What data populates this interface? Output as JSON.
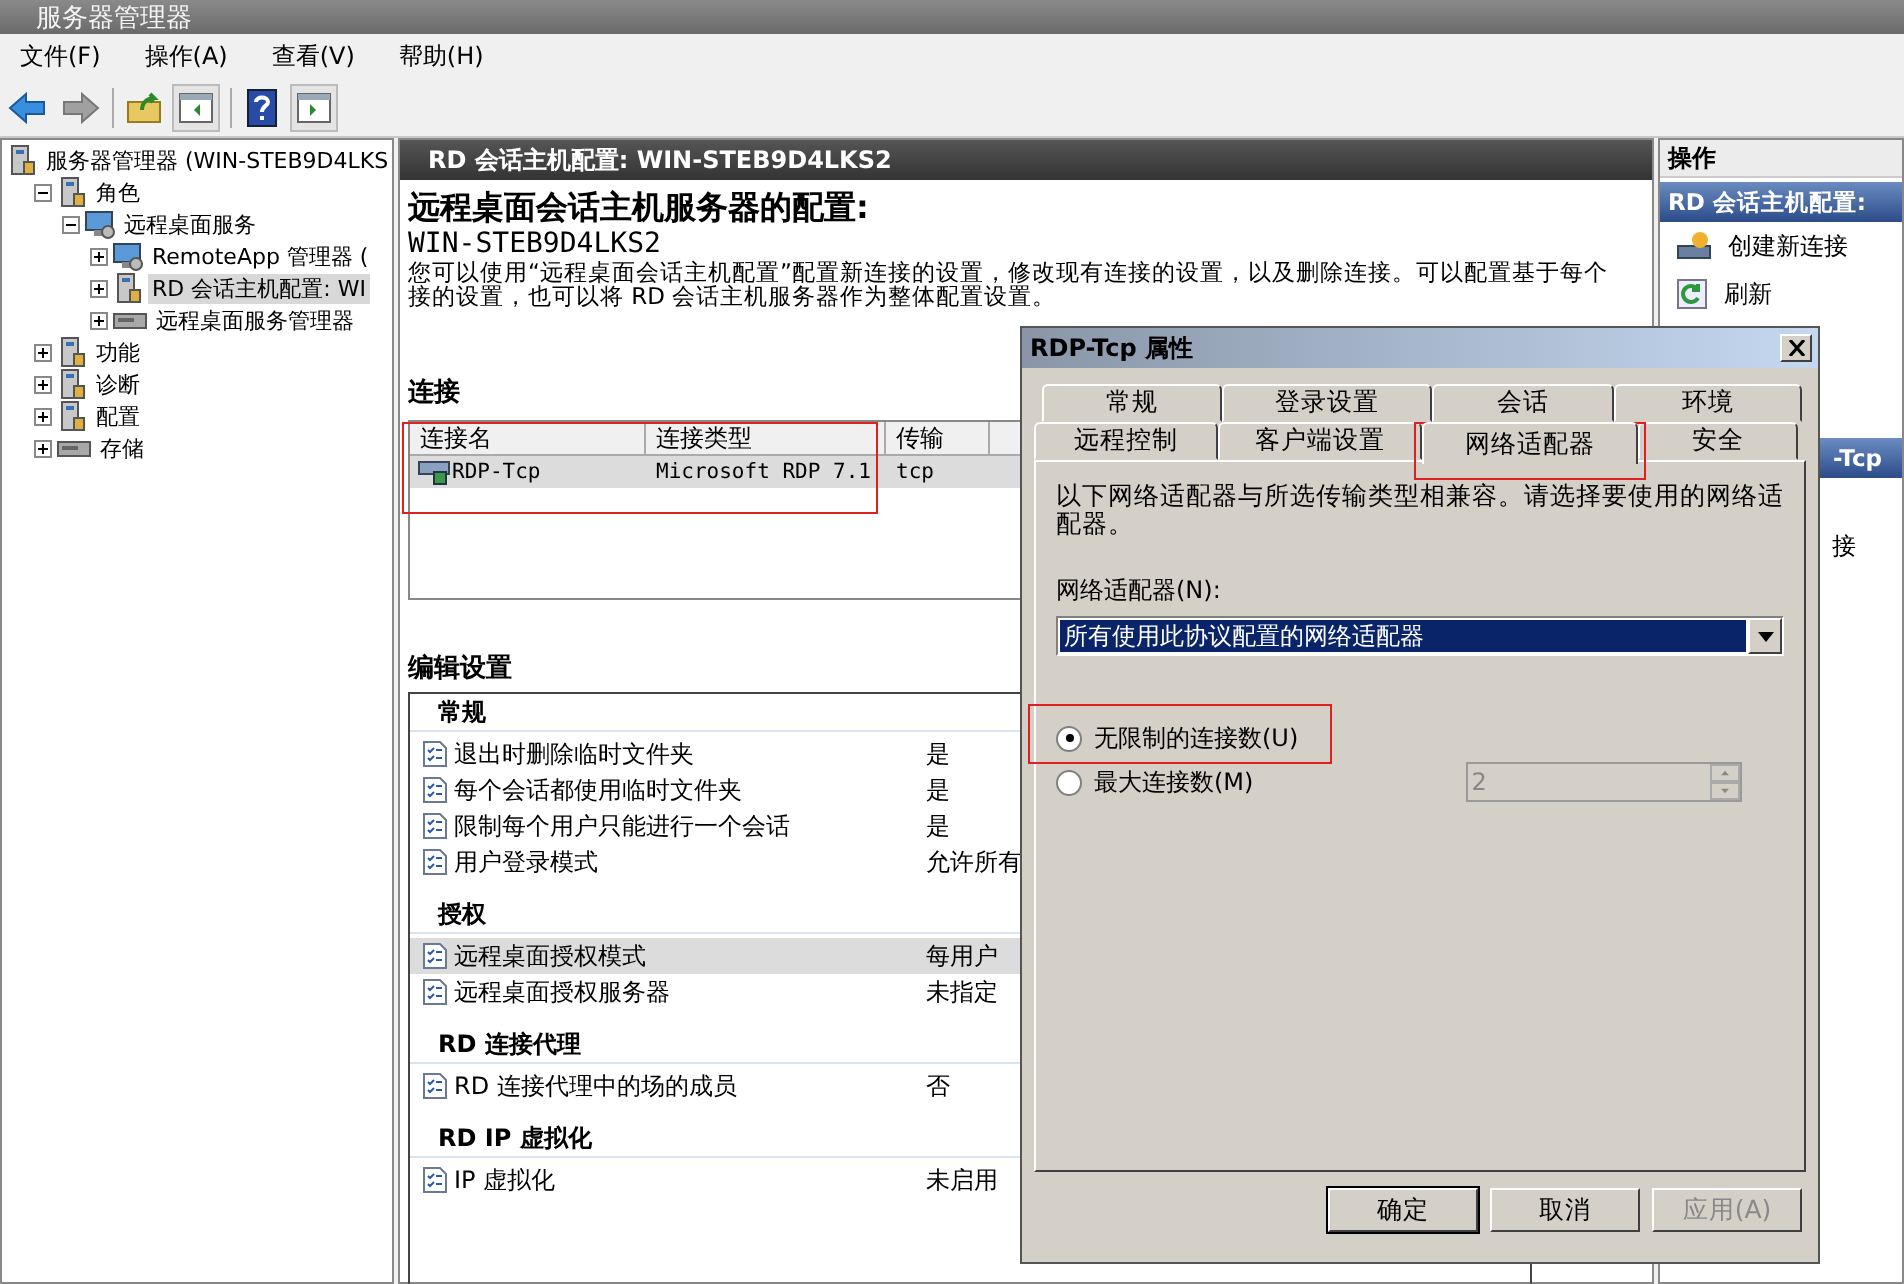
{
  "window": {
    "title": "服务器管理器"
  },
  "menu": [
    {
      "label": "文件(F)"
    },
    {
      "label": "操作(A)"
    },
    {
      "label": "查看(V)"
    },
    {
      "label": "帮助(H)"
    }
  ],
  "tree": [
    {
      "label": "服务器管理器 (WIN-STEB9D4LKS",
      "kind": "server",
      "selected": false,
      "children": [
        {
          "label": "角色",
          "kind": "server",
          "expanded": true,
          "selected": false,
          "children": [
            {
              "label": "远程桌面服务",
              "kind": "monitor",
              "expanded": true,
              "selected": false,
              "children": [
                {
                  "label": "RemoteApp 管理器 (",
                  "kind": "monitor",
                  "expanded": false,
                  "selected": false
                },
                {
                  "label": "RD 会话主机配置: WI",
                  "kind": "server",
                  "expanded": false,
                  "selected": true
                },
                {
                  "label": "远程桌面服务管理器",
                  "kind": "drive",
                  "expanded": false,
                  "selected": false
                }
              ]
            }
          ]
        },
        {
          "label": "功能",
          "kind": "server",
          "expanded": false,
          "selected": false
        },
        {
          "label": "诊断",
          "kind": "server",
          "expanded": false,
          "selected": false
        },
        {
          "label": "配置",
          "kind": "server",
          "expanded": false,
          "selected": false
        },
        {
          "label": "存储",
          "kind": "drive",
          "expanded": false,
          "selected": false
        }
      ]
    }
  ],
  "center": {
    "header": "RD 会话主机配置: WIN-STEB9D4LKS2",
    "title": "远程桌面会话主机服务器的配置:",
    "server": "WIN-STEB9D4LKS2",
    "description": [
      "您可以使用“远程桌面会话主机配置”配置新连接的设置，修改现有连接的设置，以及删除连接。可以配置基于每个",
      "接的设置，也可以将 RD 会话主机服务器作为整体配置设置。"
    ],
    "connections": {
      "title": "连接",
      "highlighted": true,
      "columns": [
        "连接名",
        "连接类型",
        "传输"
      ],
      "rows": [
        {
          "cells": [
            "RDP-Tcp",
            "Microsoft RDP 7.1",
            "tcp"
          ],
          "selected": true
        }
      ]
    },
    "settings": {
      "title": "编辑设置",
      "groups": [
        {
          "title": "常规",
          "items": [
            {
              "name": "退出时删除临时文件夹",
              "value": "是",
              "selected": false
            },
            {
              "name": "每个会话都使用临时文件夹",
              "value": "是",
              "selected": false
            },
            {
              "name": "限制每个用户只能进行一个会话",
              "value": "是",
              "selected": false
            },
            {
              "name": "用户登录模式",
              "value": "允许所有",
              "selected": false
            }
          ]
        },
        {
          "title": "授权",
          "items": [
            {
              "name": "远程桌面授权模式",
              "value": "每用户",
              "selected": true
            },
            {
              "name": "远程桌面授权服务器",
              "value": "未指定",
              "selected": false
            }
          ]
        },
        {
          "title": "RD 连接代理",
          "items": [
            {
              "name": "RD 连接代理中的场的成员",
              "value": "否",
              "selected": false
            }
          ]
        },
        {
          "title": "RD IP 虚拟化",
          "items": [
            {
              "name": "IP 虚拟化",
              "value": "未启用",
              "selected": false
            }
          ]
        }
      ]
    }
  },
  "actions": {
    "title": "操作",
    "header": "RD 会话主机配置:",
    "items": [
      {
        "label": "创建新连接",
        "kind": "new"
      },
      {
        "label": "刷新",
        "kind": "refresh"
      }
    ],
    "header2": "-Tcp",
    "fragment": "接"
  },
  "dialog": {
    "title": "RDP-Tcp 属性",
    "tab_rows": [
      [
        {
          "label": "常规",
          "selected": false,
          "highlighted": false
        },
        {
          "label": "登录设置",
          "selected": false,
          "highlighted": false
        },
        {
          "label": "会话",
          "selected": false,
          "highlighted": false
        },
        {
          "label": "环境",
          "selected": false,
          "highlighted": false
        }
      ],
      [
        {
          "label": "远程控制",
          "selected": false,
          "highlighted": false
        },
        {
          "label": "客户端设置",
          "selected": false,
          "highlighted": false
        },
        {
          "label": "网络适配器",
          "selected": true,
          "highlighted": true
        },
        {
          "label": "安全",
          "selected": false,
          "highlighted": false
        }
      ]
    ],
    "intro": "以下网络适配器与所选传输类型相兼容。请选择要使用的网络适配器。",
    "adapter_label": "网络适配器(N):",
    "adapter_value": "所有使用此协议配置的网络适配器",
    "limit_options": [
      {
        "label": "无限制的连接数(U)",
        "selected": true,
        "highlighted": true
      },
      {
        "label": "最大连接数(M)",
        "selected": false,
        "highlighted": false
      }
    ],
    "max_connections": {
      "value": "2",
      "disabled": true
    },
    "buttons": [
      {
        "label": "确定",
        "disabled": false,
        "default": true
      },
      {
        "label": "取消",
        "disabled": false,
        "default": false
      },
      {
        "label": "应用(A)",
        "disabled": true,
        "default": false
      }
    ]
  }
}
